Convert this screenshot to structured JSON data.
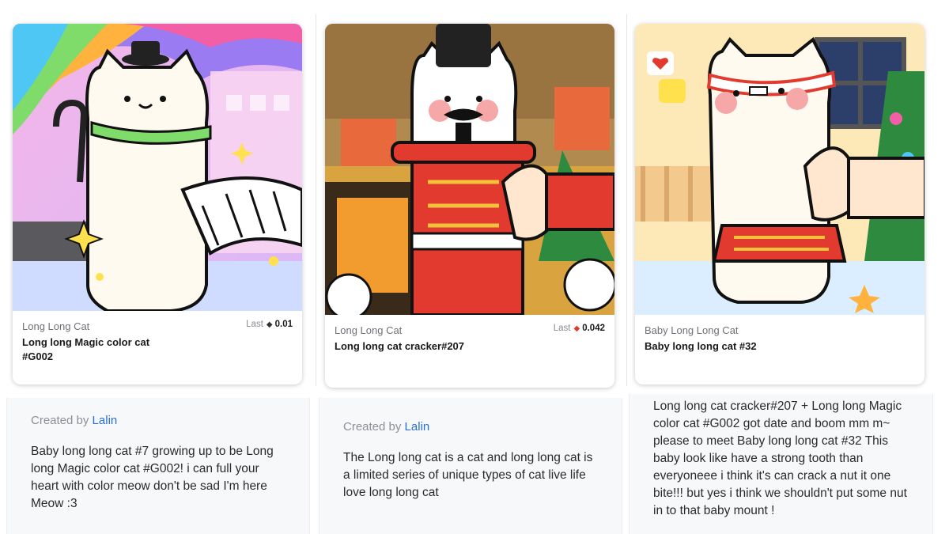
{
  "cards": [
    {
      "collection": "Long Long Cat",
      "name": "Long long Magic color cat #G002",
      "price_label": "Last",
      "price": "0.01",
      "currency_icon": "ethereum-icon",
      "created_by_label": "Created by",
      "artist": "Lalin",
      "description": "Baby long long cat #7 growing up to be Long long Magic color cat #G002! i can full your heart with color meow don't be sad I'm here Meow :3"
    },
    {
      "collection": "Long Long Cat",
      "name": "Long long cat cracker#207",
      "price_label": "Last",
      "price": "0.042",
      "currency_icon": "ethereum-icon",
      "created_by_label": "Created by",
      "artist": "Lalin",
      "description": "The Long long cat is a cat and long long cat is a limited series of unique types of cat live life love long long cat"
    },
    {
      "collection": "Baby Long Long Cat",
      "name": "Baby long long cat #32",
      "description": "Long long cat cracker#207 + Long long Magic color cat #G002 got date and boom mm m~ please to meet Baby long long cat #32 This baby look like have a strong tooth than everyoneee i think it's can crack a nut it one bite!!! but yes i think we shouldn't put some nut in to that baby mount !"
    }
  ],
  "colors": {
    "link": "#2a6fd6",
    "panel_bg": "#f7f8fa",
    "nutcracker_red": "#e23a2e"
  }
}
